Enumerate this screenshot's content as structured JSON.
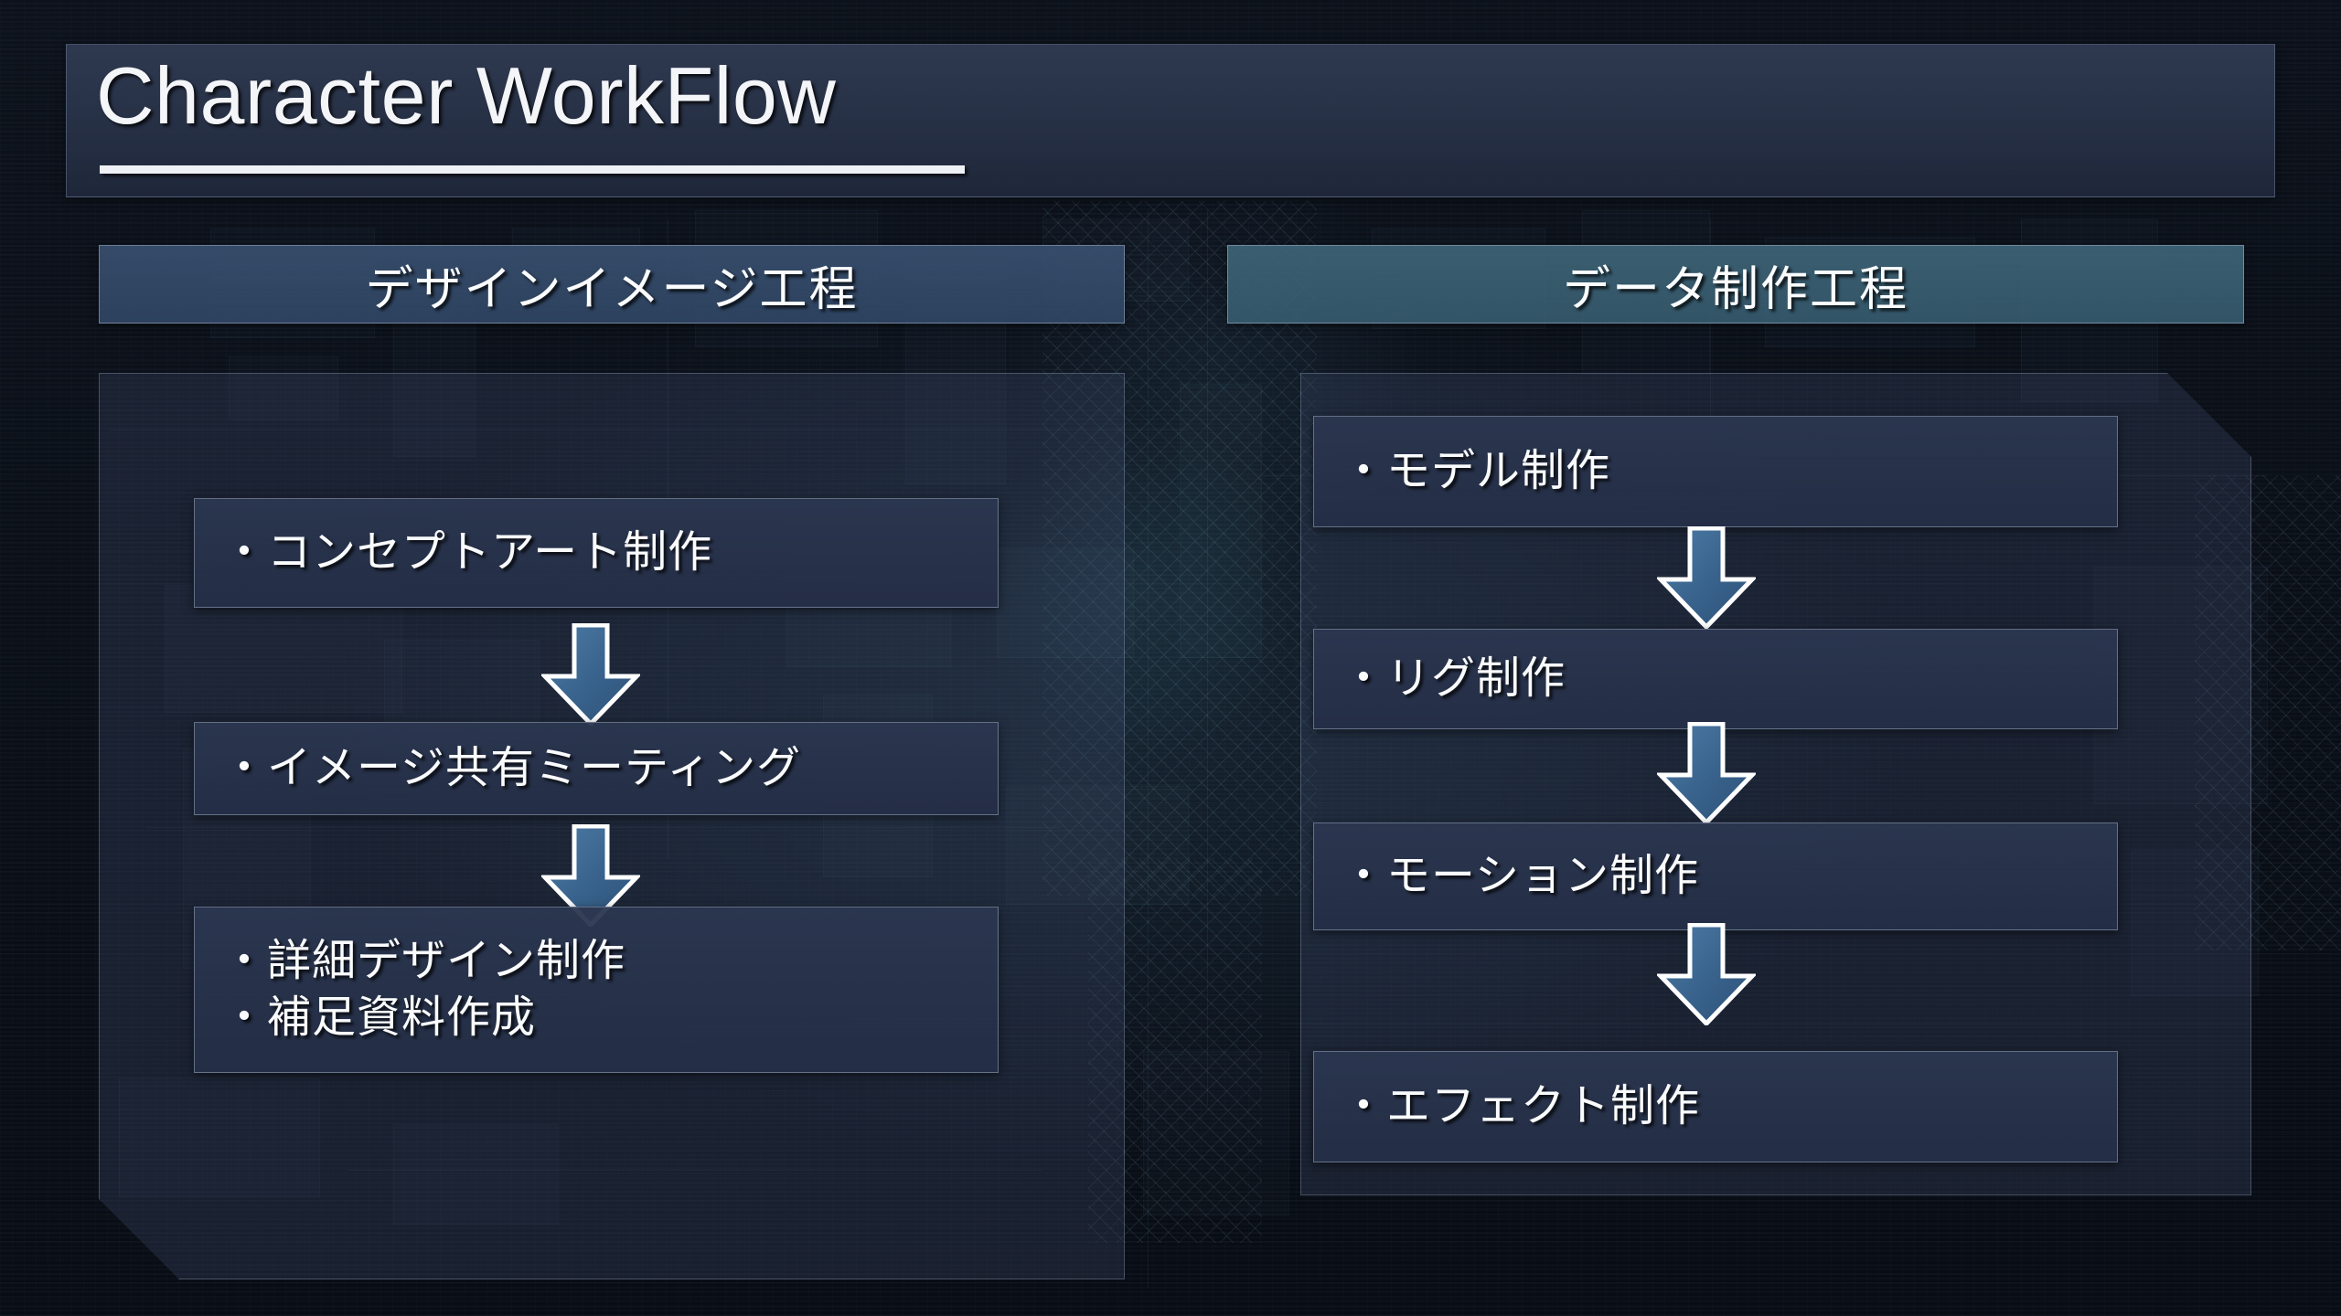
{
  "slide": {
    "title": "Character WorkFlow",
    "background_color": "#0a0e17",
    "accent_color": "#3f6f98",
    "text_color": "#fafbfc"
  },
  "columns": [
    {
      "id": "design-image-phase",
      "header": "デザインイメージ工程",
      "header_color": "#384f6e",
      "steps": [
        {
          "lines": [
            "・コンセプトアート制作"
          ]
        },
        {
          "lines": [
            "・イメージ共有ミーティング"
          ]
        },
        {
          "lines": [
            "・詳細デザイン制作",
            "・補足資料作成"
          ]
        }
      ],
      "arrows": 2
    },
    {
      "id": "data-production-phase",
      "header": "データ制作工程",
      "header_color": "#3f6679",
      "steps": [
        {
          "lines": [
            "・モデル制作"
          ]
        },
        {
          "lines": [
            "・リグ制作"
          ]
        },
        {
          "lines": [
            "・モーション制作"
          ]
        },
        {
          "lines": [
            "・エフェクト制作"
          ]
        }
      ],
      "arrows": 3
    }
  ],
  "icons": {
    "flow_arrow": "down-arrow-icon"
  }
}
